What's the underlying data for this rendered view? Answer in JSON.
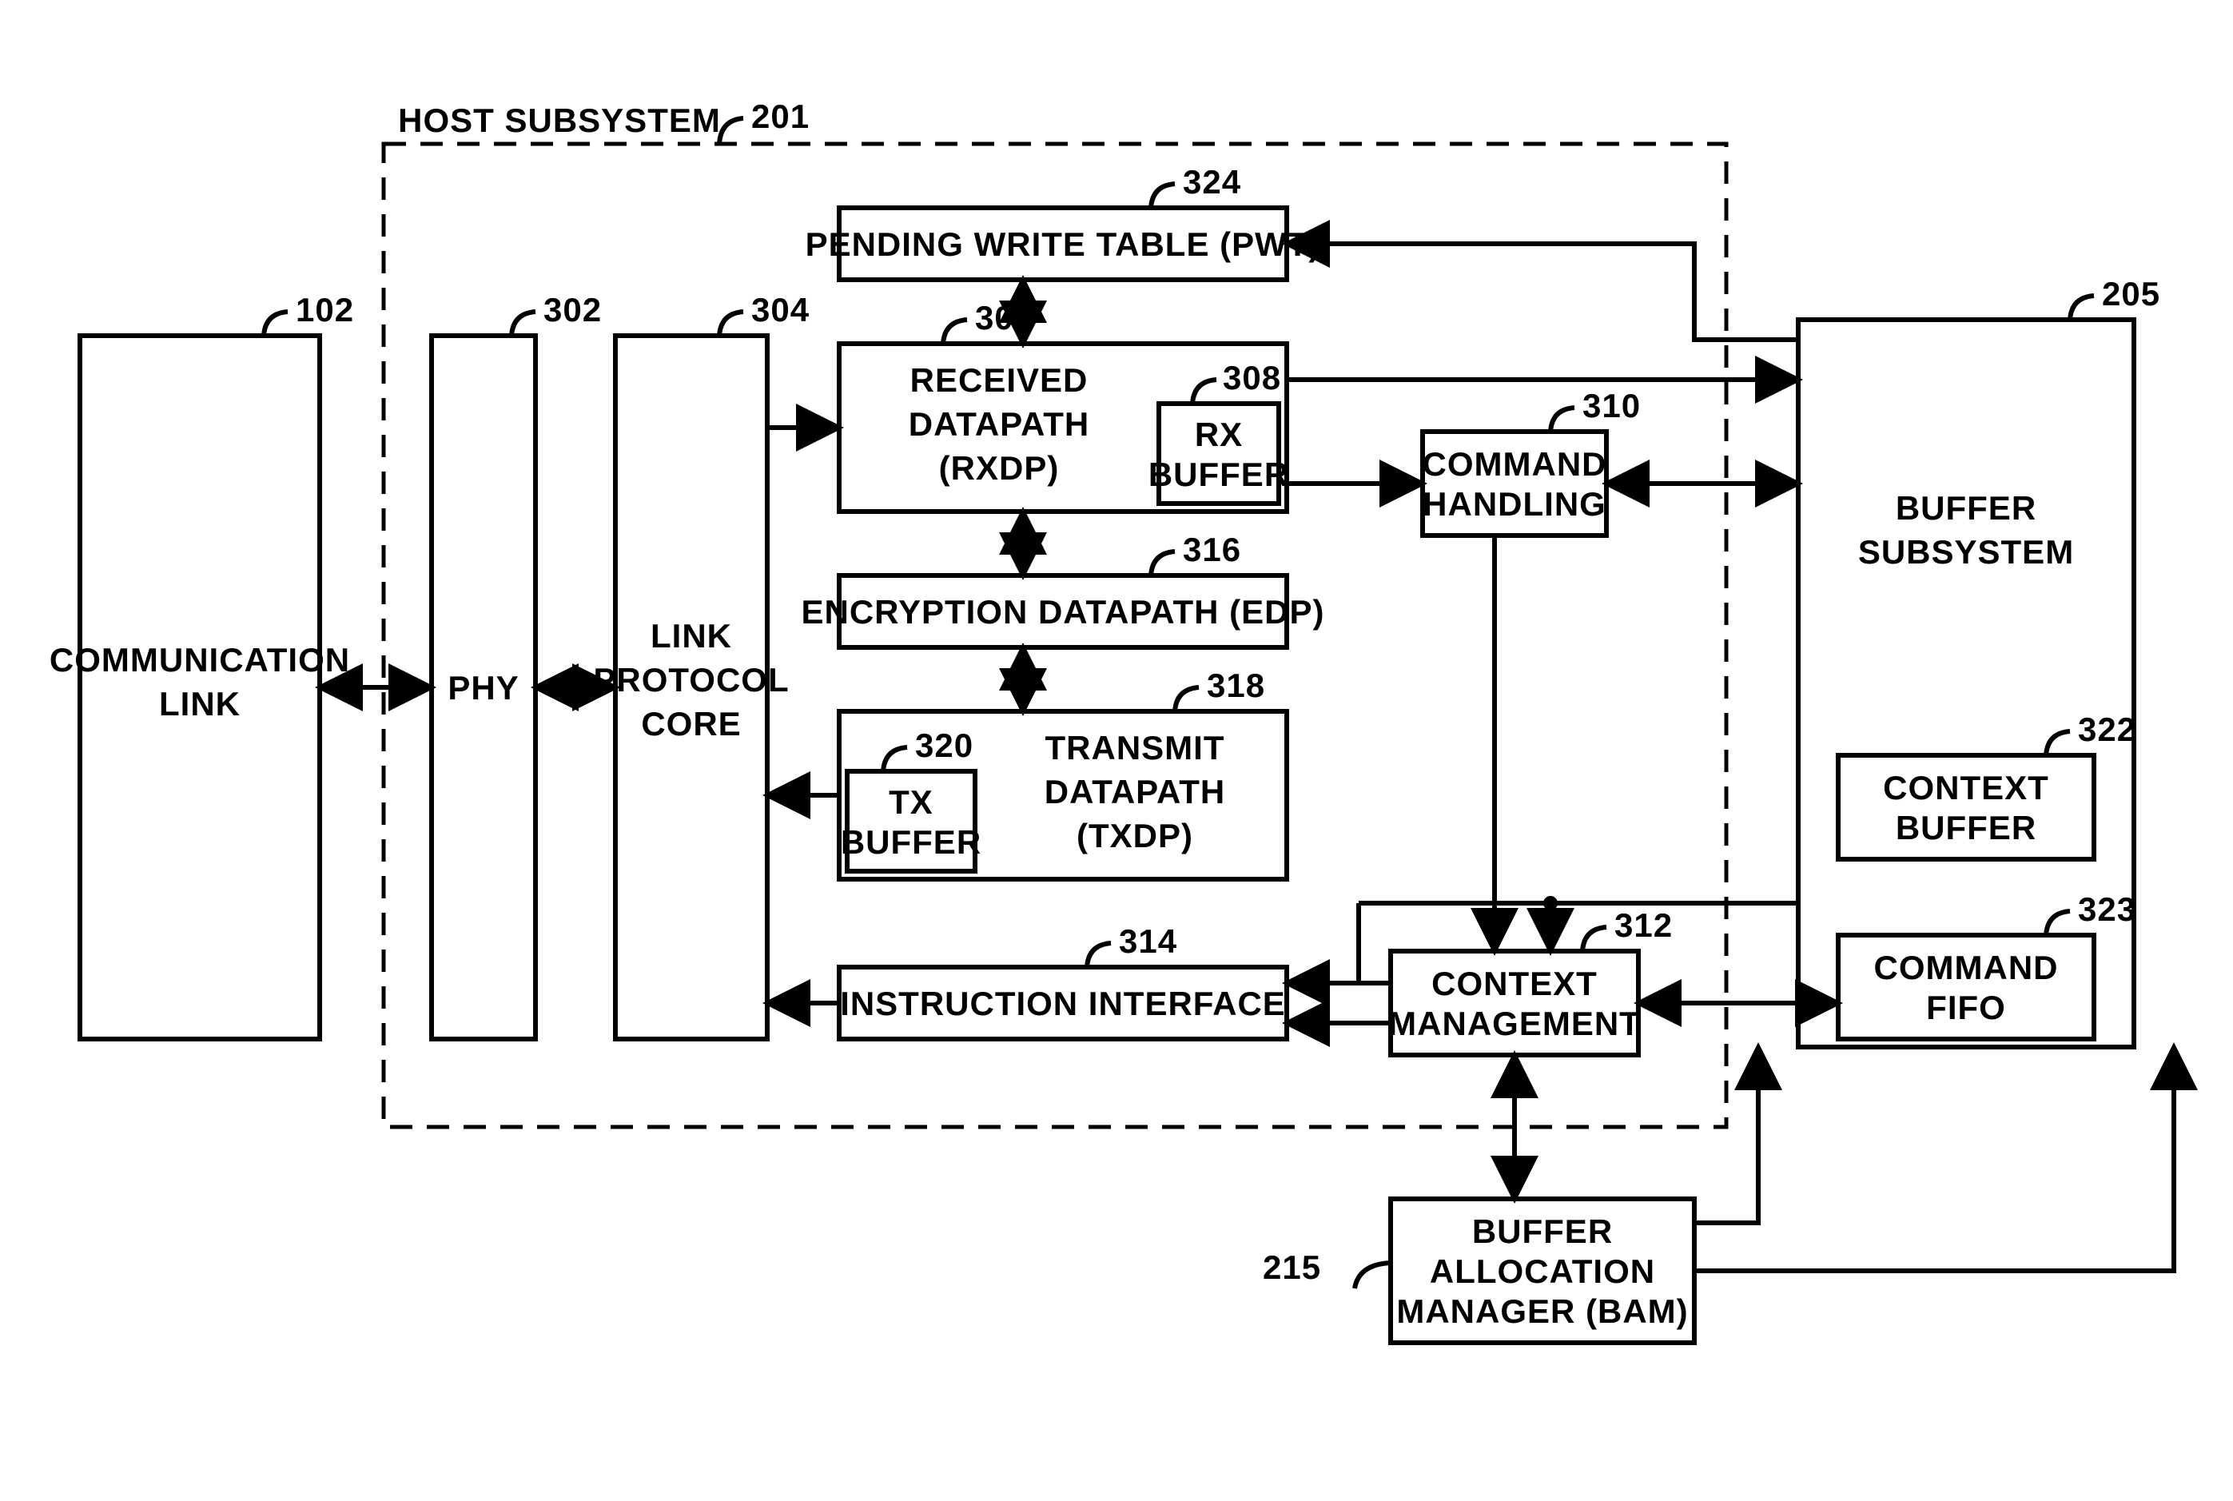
{
  "host_subsystem": {
    "ref": "201",
    "label": "HOST SUBSYSTEM"
  },
  "comm_link": {
    "ref": "102",
    "label1": "COMMUNICATION",
    "label2": "LINK"
  },
  "phy": {
    "ref": "302",
    "label": "PHY"
  },
  "lpc": {
    "ref": "304",
    "label1": "LINK",
    "label2": "PROTOCOL",
    "label3": "CORE"
  },
  "pwt": {
    "ref": "324",
    "label": "PENDING WRITE TABLE (PWT)"
  },
  "rxdp": {
    "ref": "306",
    "label1": "RECEIVED",
    "label2": "DATAPATH",
    "label3": "(RXDP)"
  },
  "rxbuf": {
    "ref": "308",
    "label1": "RX",
    "label2": "BUFFER"
  },
  "cmd_hand": {
    "ref": "310",
    "label1": "COMMAND",
    "label2": "HANDLING"
  },
  "edp": {
    "ref": "316",
    "label": "ENCRYPTION DATAPATH (EDP)"
  },
  "txdp": {
    "ref": "318",
    "label1": "TRANSMIT",
    "label2": "DATAPATH",
    "label3": "(TXDP)"
  },
  "txbuf": {
    "ref": "320",
    "label1": "TX",
    "label2": "BUFFER"
  },
  "instr": {
    "ref": "314",
    "label": "INSTRUCTION INTERFACE"
  },
  "ctx_mgmt": {
    "ref": "312",
    "label1": "CONTEXT",
    "label2": "MANAGEMENT"
  },
  "buf_sub": {
    "ref": "205",
    "label1": "BUFFER",
    "label2": "SUBSYSTEM"
  },
  "ctx_buf": {
    "ref": "322",
    "label1": "CONTEXT",
    "label2": "BUFFER"
  },
  "cmd_fifo": {
    "ref": "323",
    "label1": "COMMAND",
    "label2": "FIFO"
  },
  "bam": {
    "ref": "215",
    "label1": "BUFFER",
    "label2": "ALLOCATION",
    "label3": "MANAGER (BAM)"
  }
}
